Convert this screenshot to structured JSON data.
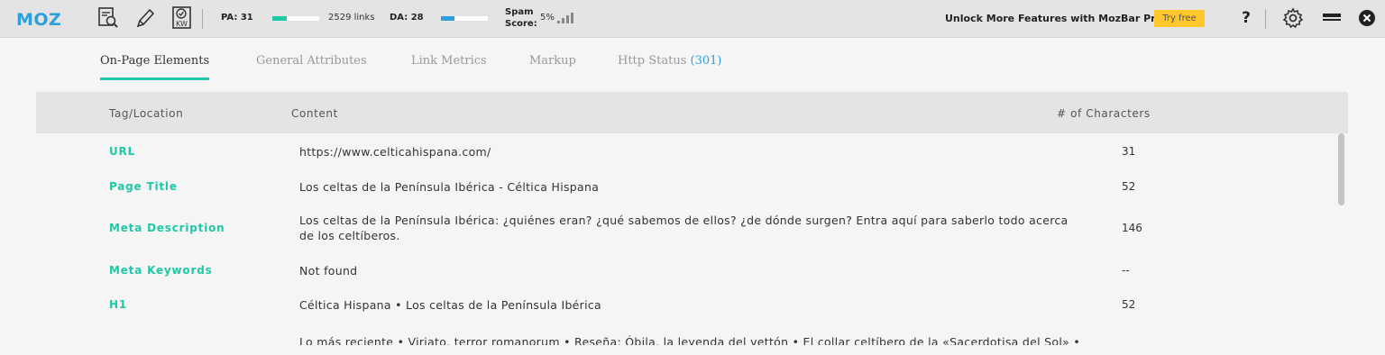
{
  "toolbar": {
    "logo": "MOZ",
    "icons": [
      "page-analysis-icon",
      "highlighter-pencil-icon",
      "keyword-kw-icon"
    ],
    "pa_label": "PA: 31",
    "pa_value": 31,
    "links_text": "2529 links",
    "da_label": "DA: 28",
    "da_value": 28,
    "spam_label": "Spam Score:",
    "spam_value": "5%",
    "unlock_text": "Unlock More Features with MozBar Premium",
    "try_free": "Try free",
    "help": "?",
    "colors": {
      "pa_bar": "#1fc8a8",
      "da_bar": "#2e9fde",
      "try_free_bg": "#ffc72c"
    }
  },
  "tabs": {
    "on_page": "On-Page Elements",
    "general": "General Attributes",
    "link_metrics": "Link Metrics",
    "markup": "Markup",
    "http_status": "Http Status",
    "http_status_count": "(301)"
  },
  "table": {
    "headers": {
      "tag": "Tag/Location",
      "content": "Content",
      "chars": "# of Characters"
    },
    "rows": [
      {
        "tag": "URL",
        "content": "https://www.celticahispana.com/",
        "count": "31"
      },
      {
        "tag": "Page Title",
        "content": "Los celtas de la Península Ibérica - Céltica Hispana",
        "count": "52"
      },
      {
        "tag": "Meta Description",
        "content": "Los celtas de la Península Ibérica: ¿quiénes eran? ¿qué sabemos de ellos? ¿de dónde surgen? Entra aquí para saberlo todo acerca de los celtíberos.",
        "count": "146"
      },
      {
        "tag": "Meta Keywords",
        "content": "Not found",
        "count": "--"
      },
      {
        "tag": "H1",
        "content": "Céltica Hispana • Los celtas de la Península Ibérica",
        "count": "52"
      }
    ],
    "partial_row": "Lo más reciente • Viriato, terror romanorum • Reseña: Óbila, la leyenda del vettón • El collar celtíbero de la «Sacerdotisa del Sol» •"
  }
}
